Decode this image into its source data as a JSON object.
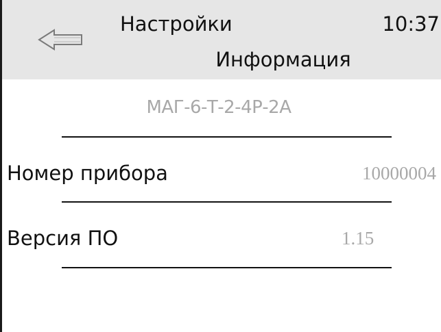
{
  "header": {
    "title": "Настройки",
    "time": "10:37",
    "subtitle": "Информация",
    "back_icon": "left-arrow-icon"
  },
  "device": {
    "model": "МАГ-6-Т-2-4Р-2А"
  },
  "rows": [
    {
      "label": "Номер прибора",
      "value": "10000004"
    },
    {
      "label": "Версия ПО",
      "value": "1.15"
    }
  ],
  "colors": {
    "header_background": "#e6e6e6",
    "text": "#111111",
    "value_text": "#a8a8a8",
    "background": "#ffffff"
  }
}
